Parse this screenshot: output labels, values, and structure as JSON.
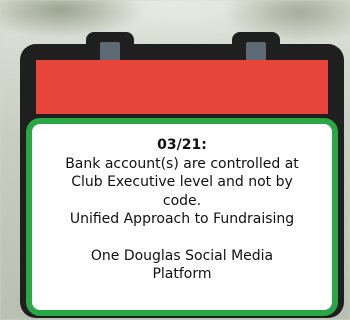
{
  "card": {
    "title": "03/21:",
    "line1": "Bank account(s) are controlled at",
    "line2": "Club Executive level and not by",
    "line3": "code.",
    "line4": "Unified Approach to Fundraising",
    "line5": "One Douglas Social Media",
    "line6": "Platform"
  },
  "colors": {
    "header_red": "#e8453a",
    "frame": "#1f1f1f",
    "note_border_green": "#29a745",
    "ring_inner": "#5e6a74"
  }
}
